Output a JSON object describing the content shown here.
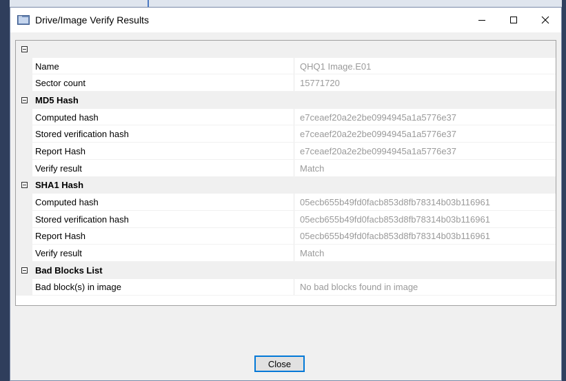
{
  "window": {
    "title": "Drive/Image Verify Results",
    "minimize_icon": "minimize-icon",
    "maximize_icon": "maximize-icon",
    "close_icon": "close-icon"
  },
  "grid": {
    "root": {
      "properties": [
        {
          "name": "Name",
          "value": "QHQ1 Image.E01"
        },
        {
          "name": "Sector count",
          "value": "15771720"
        }
      ]
    },
    "md5": {
      "label": "MD5 Hash",
      "properties": [
        {
          "name": "Computed hash",
          "value": "e7ceaef20a2e2be0994945a1a5776e37"
        },
        {
          "name": "Stored verification hash",
          "value": "e7ceaef20a2e2be0994945a1a5776e37"
        },
        {
          "name": "Report Hash",
          "value": "e7ceaef20a2e2be0994945a1a5776e37"
        },
        {
          "name": "Verify result",
          "value": "Match"
        }
      ]
    },
    "sha1": {
      "label": "SHA1 Hash",
      "properties": [
        {
          "name": "Computed hash",
          "value": "05ecb655b49fd0facb853d8fb78314b03b116961"
        },
        {
          "name": "Stored verification hash",
          "value": "05ecb655b49fd0facb853d8fb78314b03b116961"
        },
        {
          "name": "Report Hash",
          "value": "05ecb655b49fd0facb853d8fb78314b03b116961"
        },
        {
          "name": "Verify result",
          "value": "Match"
        }
      ]
    },
    "bad_blocks": {
      "label": "Bad Blocks List",
      "properties": [
        {
          "name": "Bad block(s) in image",
          "value": "No bad blocks found in image"
        }
      ]
    }
  },
  "buttons": {
    "close_label": "Close"
  }
}
